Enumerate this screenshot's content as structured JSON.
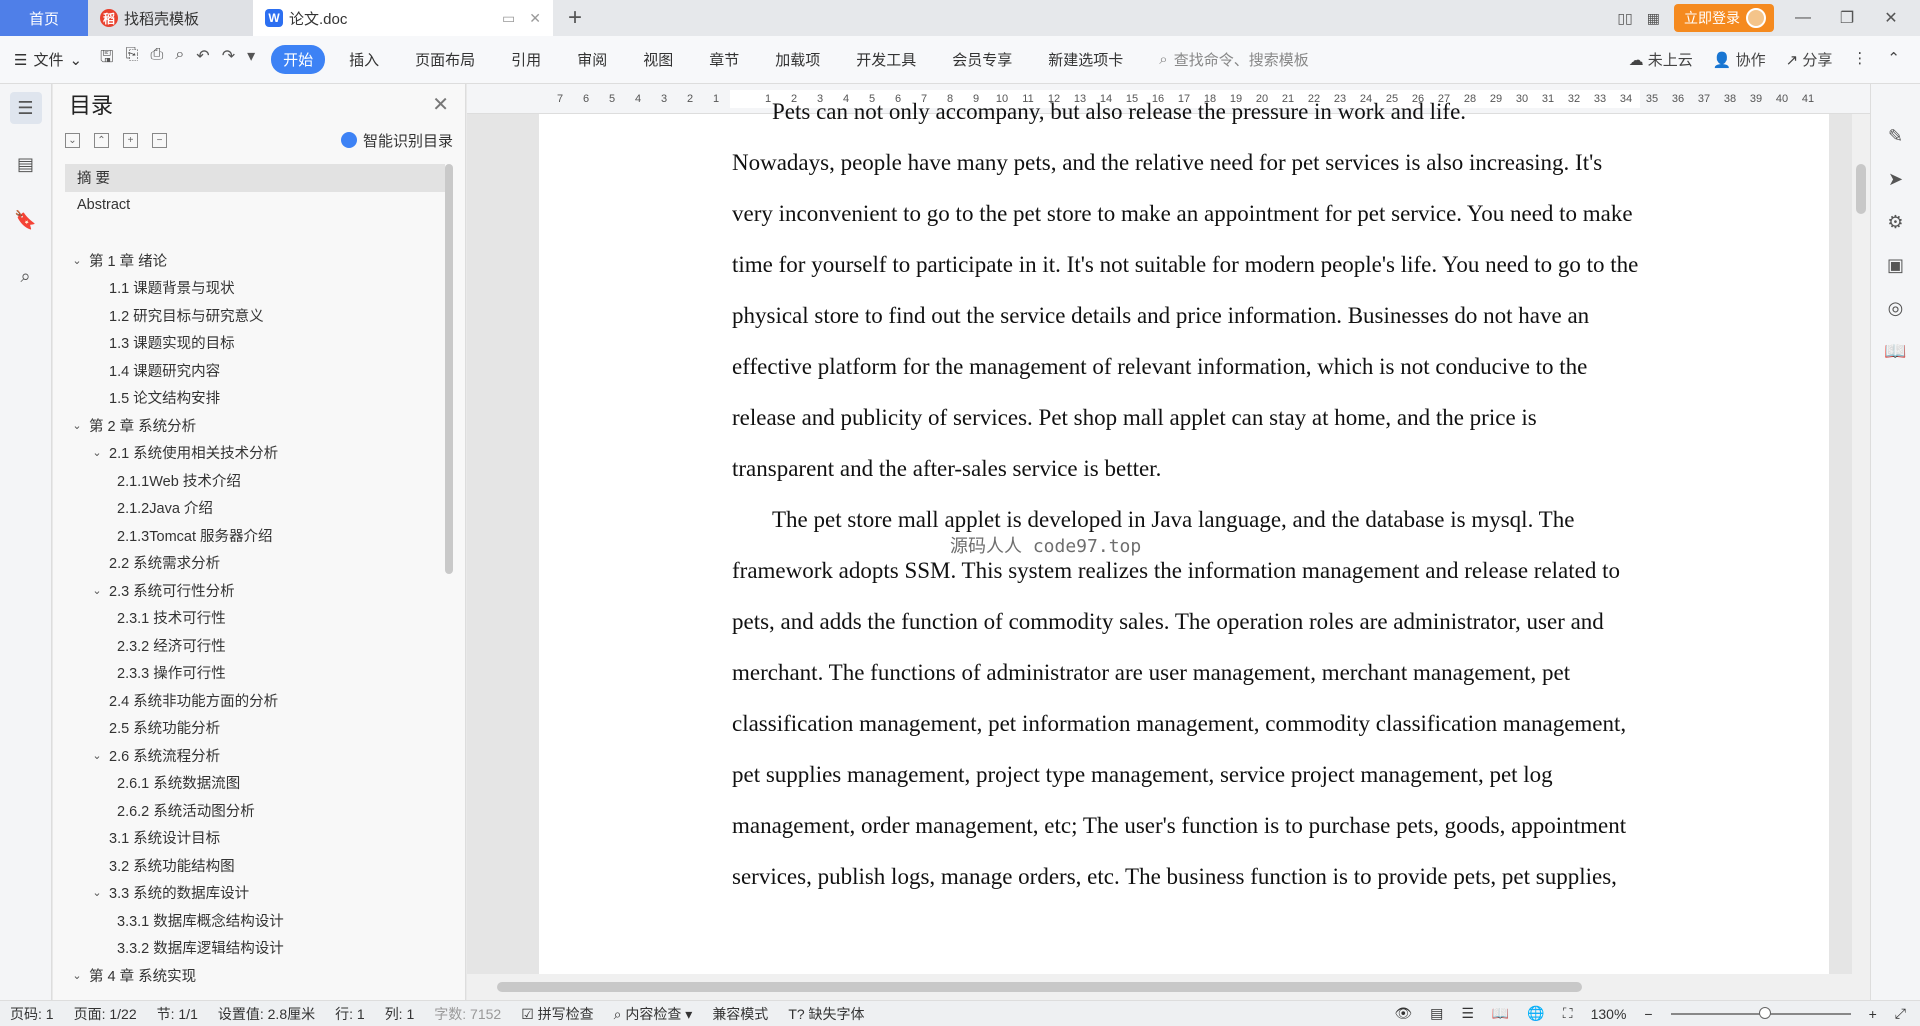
{
  "titlebar": {
    "home_tab": "首页",
    "tabs": [
      {
        "label": "找稻壳模板"
      },
      {
        "label": "论文.doc"
      }
    ],
    "login_label": "立即登录"
  },
  "ribbon": {
    "file_label": "文件",
    "tabs": [
      "开始",
      "插入",
      "页面布局",
      "引用",
      "审阅",
      "视图",
      "章节",
      "加载项",
      "开发工具",
      "会员专享",
      "新建选项卡"
    ],
    "search_placeholder": "查找命令、搜索模板",
    "cloud_label": "未上云",
    "collab_label": "协作",
    "share_label": "分享"
  },
  "toc": {
    "title": "目录",
    "smart_label": "智能识别目录",
    "items": [
      {
        "label": "摘  要",
        "level": 0,
        "sel": true
      },
      {
        "label": "Abstract",
        "level": 0
      },
      {
        "label": "",
        "level": -1
      },
      {
        "label": "第 1 章  绪论",
        "level": 1,
        "chev": true
      },
      {
        "label": "1.1 课题背景与现状",
        "level": 2
      },
      {
        "label": "1.2 研究目标与研究意义",
        "level": 2
      },
      {
        "label": "1.3 课题实现的目标",
        "level": 2
      },
      {
        "label": "1.4  课题研究内容",
        "level": 2
      },
      {
        "label": "1.5  论文结构安排",
        "level": 2
      },
      {
        "label": "第 2 章  系统分析",
        "level": 1,
        "chev": true
      },
      {
        "label": "2.1 系统使用相关技术分析",
        "level": 2,
        "chev": true
      },
      {
        "label": "2.1.1Web 技术介绍",
        "level": 3
      },
      {
        "label": "2.1.2Java 介绍",
        "level": 3
      },
      {
        "label": "2.1.3Tomcat 服务器介绍",
        "level": 3
      },
      {
        "label": "2.2 系统需求分析",
        "level": 2
      },
      {
        "label": "2.3 系统可行性分析",
        "level": 2,
        "chev": true
      },
      {
        "label": "2.3.1 技术可行性",
        "level": 3
      },
      {
        "label": "2.3.2 经济可行性",
        "level": 3
      },
      {
        "label": "2.3.3 操作可行性",
        "level": 3
      },
      {
        "label": "2.4 系统非功能方面的分析",
        "level": 2
      },
      {
        "label": "2.5 系统功能分析",
        "level": 2
      },
      {
        "label": "2.6 系统流程分析",
        "level": 2,
        "chev": true
      },
      {
        "label": "2.6.1 系统数据流图",
        "level": 3
      },
      {
        "label": "2.6.2 系统活动图分析",
        "level": 3
      },
      {
        "label": "3.1 系统设计目标",
        "level": 2
      },
      {
        "label": "3.2 系统功能结构图",
        "level": 2
      },
      {
        "label": "3.3 系统的数据库设计",
        "level": 2,
        "chev": true
      },
      {
        "label": "3.3.1 数据库概念结构设计",
        "level": 3
      },
      {
        "label": "3.3.2 数据库逻辑结构设计",
        "level": 3
      },
      {
        "label": "第 4 章  系统实现",
        "level": 1,
        "chev": true
      }
    ]
  },
  "ruler": {
    "ticks": [
      "7",
      "6",
      "5",
      "4",
      "3",
      "2",
      "1",
      "",
      "1",
      "2",
      "3",
      "4",
      "5",
      "6",
      "7",
      "8",
      "9",
      "10",
      "11",
      "12",
      "13",
      "14",
      "15",
      "16",
      "17",
      "18",
      "19",
      "20",
      "21",
      "22",
      "23",
      "24",
      "25",
      "26",
      "27",
      "28",
      "29",
      "30",
      "31",
      "32",
      "33",
      "34",
      "35",
      "36",
      "37",
      "38",
      "39",
      "40",
      "41"
    ]
  },
  "document": {
    "cut_line": "Pets can not only accompany, but also release the pressure in work and life.",
    "para1": "Nowadays, people have many pets, and the relative need for pet services is also increasing. It's very inconvenient to go to the pet store to make an appointment for pet service. You need to make time for yourself to participate in it. It's not suitable for modern people's life. You need to go to the physical store to find out the service details and price information. Businesses do not have an effective platform for the management of relevant information, which is not conducive to the release and publicity of services. Pet shop mall applet can stay at home, and the price is transparent and the after-sales service is better.",
    "para2": "The pet store mall applet is developed in Java language, and the database is mysql. The framework adopts SSM. This system realizes the information management and release related to pets, and adds the function of commodity sales. The operation roles are administrator, user and merchant. The functions of administrator are user management, merchant management, pet classification management, pet information management, commodity classification management, pet supplies management, project type management, service project management, pet log management, order management, etc; The user's function is to purchase pets, goods, appointment services, publish logs, manage orders, etc. The business function is to provide pets, pet supplies,",
    "watermark": "源码人人 code97.top"
  },
  "status": {
    "page_code": "页码: 1",
    "page": "页面: 1/22",
    "section": "节: 1/1",
    "setting": "设置值: 2.8厘米",
    "row": "行: 1",
    "col": "列: 1",
    "word_count": "字数: 7152",
    "spell": "拼写检查",
    "content_check": "内容检查",
    "compat": "兼容模式",
    "missing_font": "缺失字体",
    "zoom": "130%"
  }
}
